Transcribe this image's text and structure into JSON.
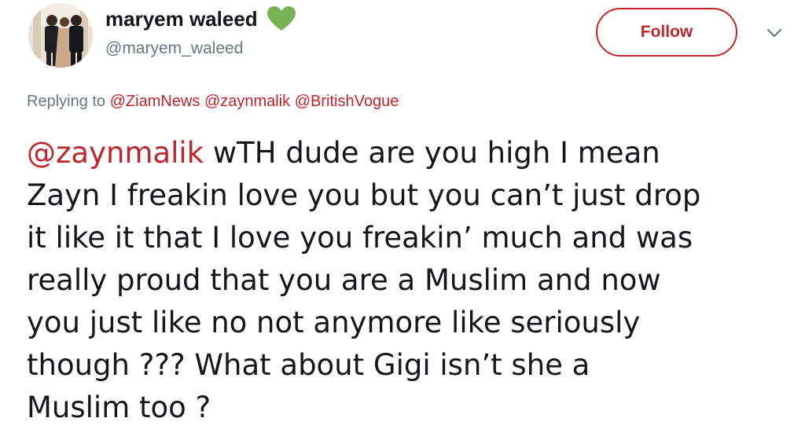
{
  "user": {
    "display_name": "maryem waleed",
    "username": "@maryem_waleed",
    "badge_icon": "green-heart-icon",
    "badge_color": "#77b255"
  },
  "actions": {
    "follow_label": "Follow",
    "more_icon": "chevron-down-icon"
  },
  "reply": {
    "prefix": "Replying to",
    "mentions": [
      "@ZiamNews",
      "@zaynmalik",
      "@BritishVogue"
    ]
  },
  "tweet": {
    "mention": "@zaynmalik",
    "lines": [
      "wTH dude are you high I mean",
      "Zayn I freakin love you but you can’t just drop",
      "it like it that I love you freakin’ much and was",
      "really proud that you are a Muslim and now",
      "you just like no not anymore like seriously",
      "though ??? What about Gigi isn’t she a",
      "Muslim too ?"
    ]
  },
  "colors": {
    "accent": "#c0252c",
    "text": "#14171a",
    "secondary": "#657786"
  }
}
